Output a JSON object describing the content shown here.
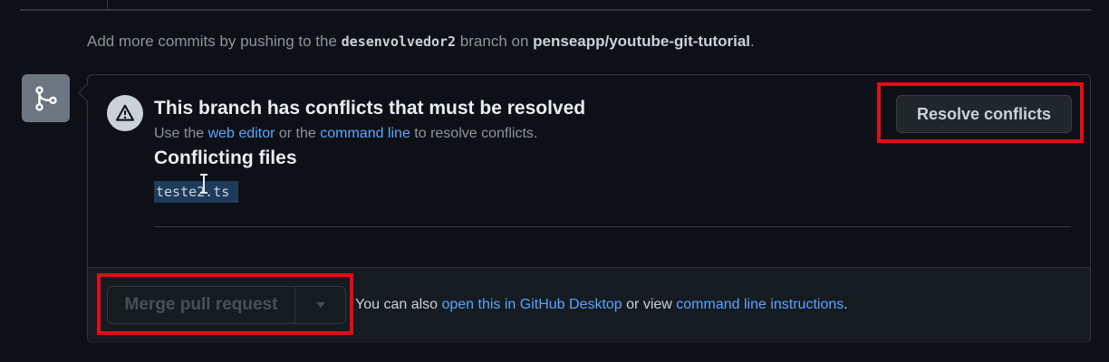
{
  "hint": {
    "prefix": "Add more commits by pushing to the ",
    "branch": "desenvolvedor2",
    "middle": " branch on ",
    "repo": "penseapp/youtube-git-tutorial",
    "suffix": "."
  },
  "conflict": {
    "title": "This branch has conflicts that must be resolved",
    "sub_prefix": "Use the ",
    "web_editor": "web editor",
    "sub_or": " or the ",
    "command_line": "command line",
    "sub_suffix": " to resolve conflicts.",
    "files_title": "Conflicting files",
    "files": [
      "teste2.ts"
    ]
  },
  "actions": {
    "resolve_label": "Resolve conflicts",
    "merge_label": "Merge pull request"
  },
  "footer": {
    "prefix": "You can also ",
    "github_desktop": "open this in GitHub Desktop",
    "middle": " or view ",
    "instructions": "command line instructions",
    "suffix": "."
  },
  "icons": {
    "timeline": "git-merge-icon",
    "warning": "alert-icon",
    "dropdown": "triangle-down-icon"
  },
  "colors": {
    "background": "#0d1117",
    "link": "#58a6ff",
    "highlight": "#e00d17"
  }
}
